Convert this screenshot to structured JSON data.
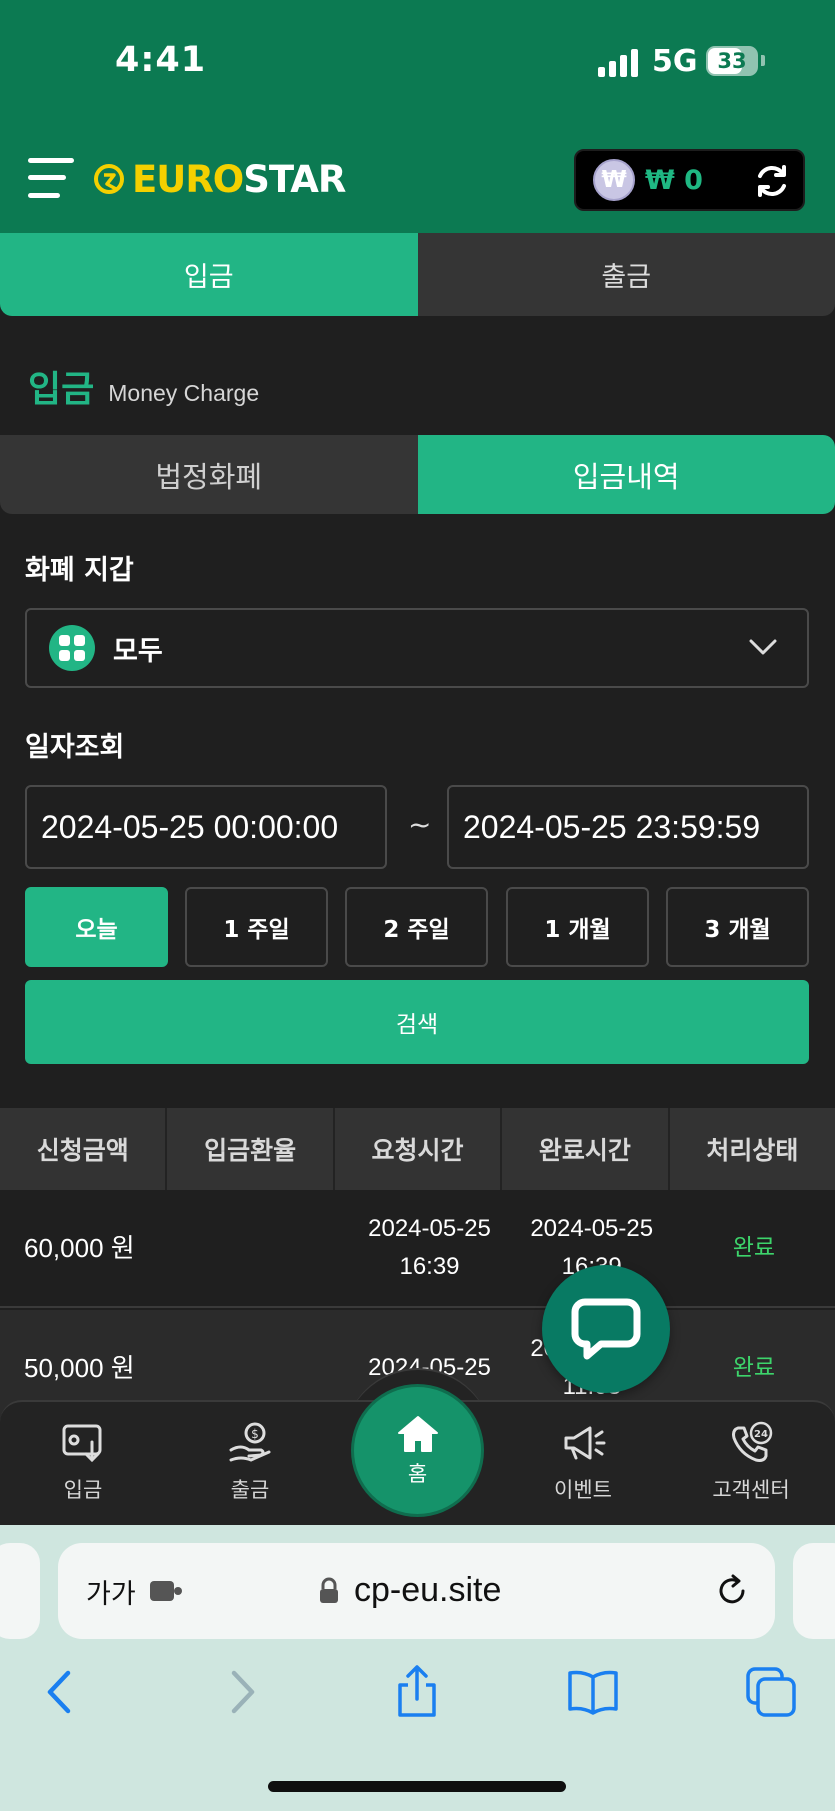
{
  "status_bar": {
    "time": "4:41",
    "network": "5G",
    "battery": "33"
  },
  "header": {
    "logo_euro": "EURO",
    "logo_star": "STAR",
    "currency_symbol": "₩",
    "balance": "₩ 0"
  },
  "top_tabs": [
    {
      "label": "입금",
      "active": true
    },
    {
      "label": "출금",
      "active": false
    }
  ],
  "section": {
    "title": "입금",
    "subtitle": "Money Charge"
  },
  "sub_tabs": [
    {
      "label": "법정화폐",
      "active": false
    },
    {
      "label": "입금내역",
      "active": true
    }
  ],
  "wallet_filter": {
    "label": "화폐 지갑",
    "value": "모두"
  },
  "date_filter": {
    "label": "일자조회",
    "start": "2024-05-25 00:00:00",
    "separator": "~",
    "end": "2024-05-25 23:59:59",
    "ranges": [
      {
        "label": "오늘",
        "active": true
      },
      {
        "label": "1 주일",
        "active": false
      },
      {
        "label": "2 주일",
        "active": false
      },
      {
        "label": "1 개월",
        "active": false
      },
      {
        "label": "3 개월",
        "active": false
      }
    ],
    "search_label": "검색"
  },
  "table": {
    "columns": [
      "신청금액",
      "입금환율",
      "요청시간",
      "완료시간",
      "처리상태"
    ],
    "rows": [
      {
        "amount": "60,000 원",
        "rate": "",
        "request_date": "2024-05-25",
        "request_time": "16:39",
        "complete_date": "2024-05-25",
        "complete_time": "16:39",
        "status": "완료"
      },
      {
        "amount": "50,000 원",
        "rate": "",
        "request_date": "2024-05-25",
        "request_time": "",
        "complete_date": "2024-05-25",
        "complete_time": "11:08",
        "status": "완료"
      }
    ]
  },
  "bottom_nav": [
    {
      "label": "입금",
      "icon": "deposit-icon"
    },
    {
      "label": "출금",
      "icon": "withdraw-icon"
    },
    {
      "label": "홈",
      "icon": "home-icon"
    },
    {
      "label": "이벤트",
      "icon": "megaphone-icon"
    },
    {
      "label": "고객센터",
      "icon": "support-24-icon"
    }
  ],
  "browser": {
    "aa_label": "가가",
    "url": "cp-eu.site"
  },
  "colors": {
    "brand_green": "#0c7a52",
    "accent": "#22b585",
    "status_done": "#3dd46b",
    "logo_yellow": "#f4d000"
  }
}
